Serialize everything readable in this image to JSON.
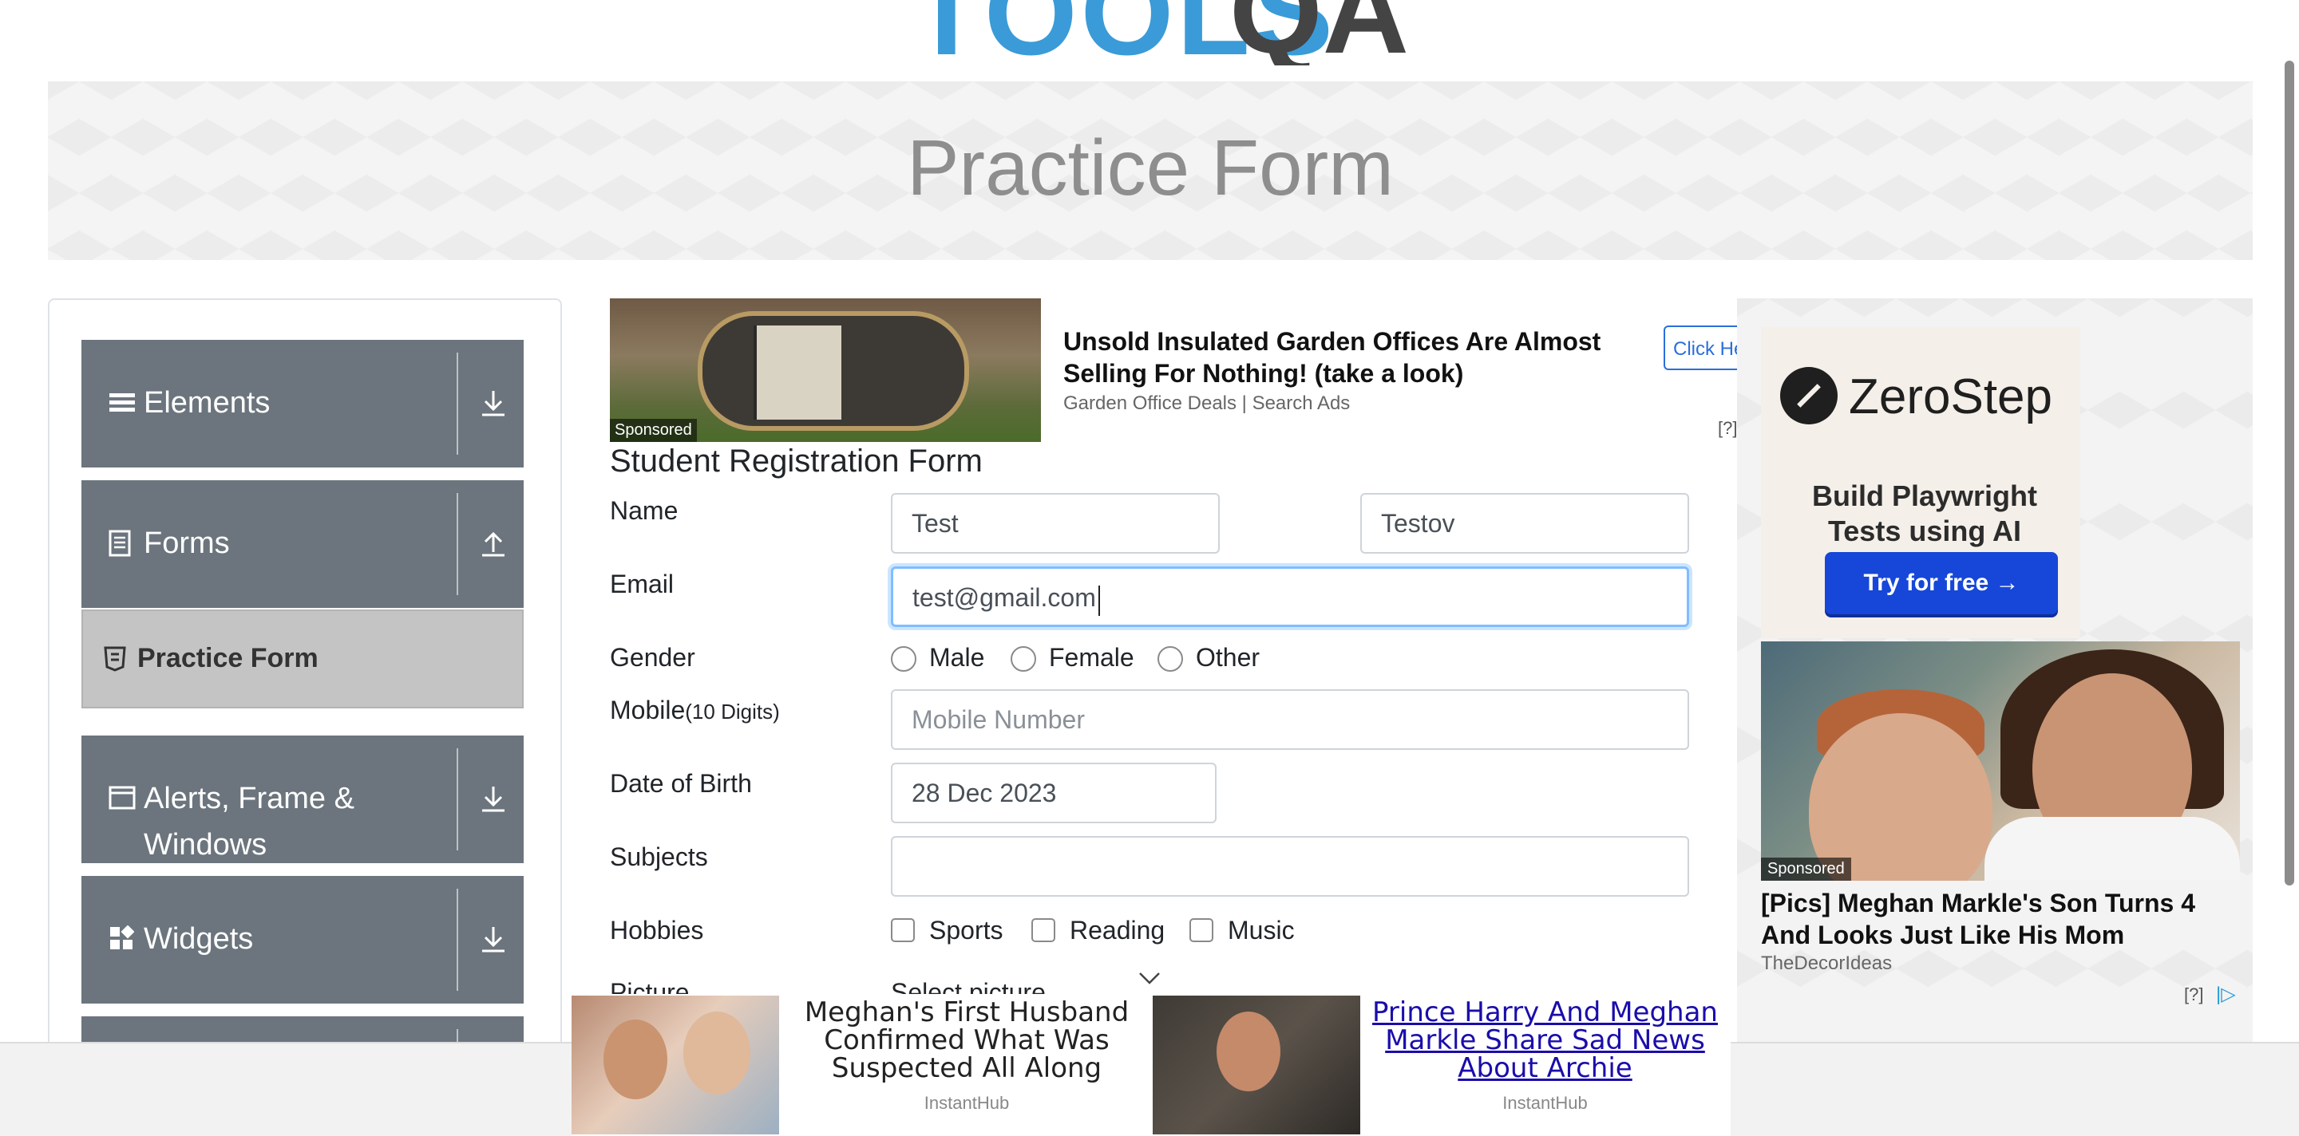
{
  "header": {
    "logo_text": "TOOLSQA",
    "page_title": "Practice Form"
  },
  "sidebar": {
    "groups": [
      {
        "label": "Elements",
        "icon": "hamburger-icon",
        "expanded": false
      },
      {
        "label": "Forms",
        "icon": "document-icon",
        "expanded": true
      },
      {
        "label": "Alerts, Frame & Windows",
        "icon": "window-icon",
        "expanded": false
      },
      {
        "label": "Widgets",
        "icon": "widgets-icon",
        "expanded": false
      }
    ],
    "active_item": "Practice Form"
  },
  "ad_top": {
    "title": "Unsold Insulated Garden Offices Are Almost Selling For Nothing! (take a look)",
    "source": "Garden Office Deals | Search Ads",
    "cta": "Click He",
    "sponsored": "Sponsored",
    "info": "[?]"
  },
  "form": {
    "title": "Student Registration Form",
    "name_label": "Name",
    "first_name": "Test",
    "last_name": "Testov",
    "email_label": "Email",
    "email": "test@gmail.com",
    "gender_label": "Gender",
    "genders": [
      "Male",
      "Female",
      "Other"
    ],
    "mobile_label": "Mobile",
    "mobile_hint": "(10 Digits)",
    "mobile_placeholder": "Mobile Number",
    "dob_label": "Date of Birth",
    "dob": "28 Dec 2023",
    "subjects_label": "Subjects",
    "hobbies_label": "Hobbies",
    "hobbies": [
      "Sports",
      "Reading",
      "Music"
    ],
    "picture_label": "Picture",
    "picture_button": "Select picture"
  },
  "ad_right": {
    "brand": "ZeroStep",
    "tagline": "Build Playwright Tests using AI",
    "button": "Try for free →",
    "sponsored": "Sponsored",
    "headline": "[Pics] Meghan Markle's Son Turns 4 And Looks Just Like His Mom",
    "source": "TheDecorIdeas",
    "info": "[?]",
    "adchoices": "|▷"
  },
  "ad_bottom": {
    "left_title": "Meghan's First Husband Confirmed What Was Suspected All Along",
    "left_source": "InstantHub",
    "right_title": "Prince Harry And Meghan Markle Share Sad News About Archie",
    "right_source": "InstantHub"
  }
}
